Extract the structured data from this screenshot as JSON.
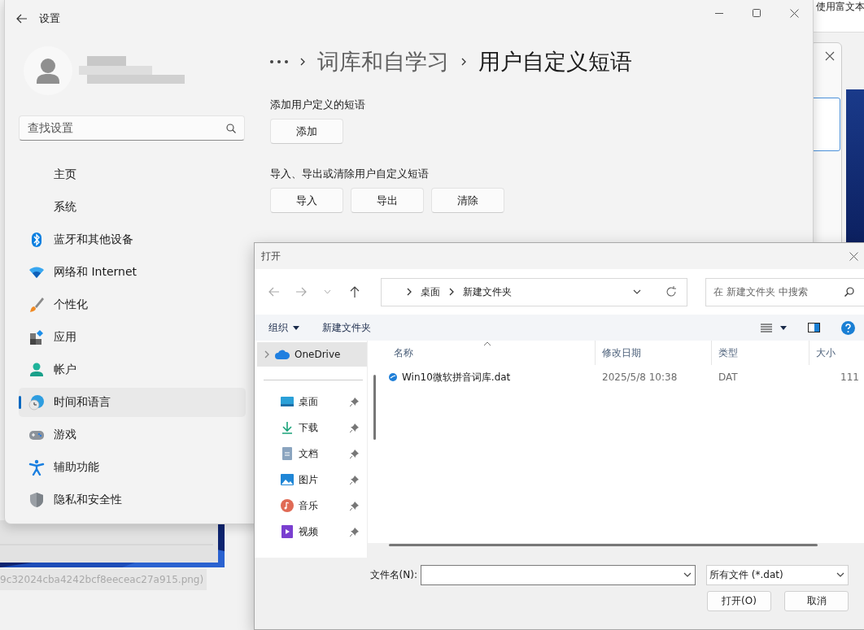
{
  "background": {
    "window_text": "使用富文本",
    "file_link": "9c32024cba4242bcf8eeceac27a915.png)"
  },
  "settings": {
    "title": "设置",
    "search": {
      "placeholder": "查找设置"
    },
    "nav": [
      {
        "label": "主页",
        "selected": false
      },
      {
        "label": "系统",
        "selected": false
      },
      {
        "label": "蓝牙和其他设备",
        "selected": false
      },
      {
        "label": "网络和 Internet",
        "selected": false
      },
      {
        "label": "个性化",
        "selected": false
      },
      {
        "label": "应用",
        "selected": false
      },
      {
        "label": "帐户",
        "selected": false
      },
      {
        "label": "时间和语言",
        "selected": true
      },
      {
        "label": "游戏",
        "selected": false
      },
      {
        "label": "辅助功能",
        "selected": false
      },
      {
        "label": "隐私和安全性",
        "selected": false
      }
    ],
    "breadcrumb": [
      {
        "label": "词库和自学习",
        "current": false
      },
      {
        "label": "用户自定义短语",
        "current": true
      }
    ],
    "sections": [
      {
        "label": "添加用户定义的短语",
        "buttons": [
          "添加"
        ]
      },
      {
        "label": "导入、导出或清除用户自定义短语",
        "buttons": [
          "导入",
          "导出",
          "清除"
        ]
      }
    ]
  },
  "dialog": {
    "title": "打开",
    "path": [
      "桌面",
      "新建文件夹"
    ],
    "search": {
      "placeholder": "在 新建文件夹 中搜索"
    },
    "toolbar": {
      "organize": "组织",
      "new_folder": "新建文件夹"
    },
    "nav_top": {
      "label": "OneDrive",
      "selected": true
    },
    "quick_access": [
      {
        "label": "桌面",
        "pinned": true,
        "selected": false
      },
      {
        "label": "下载",
        "pinned": true,
        "selected": false
      },
      {
        "label": "文档",
        "pinned": true,
        "selected": false
      },
      {
        "label": "图片",
        "pinned": true,
        "selected": false
      },
      {
        "label": "音乐",
        "pinned": true,
        "selected": false
      },
      {
        "label": "视频",
        "pinned": true,
        "selected": false
      }
    ],
    "columns": [
      "名称",
      "修改日期",
      "类型",
      "大小"
    ],
    "rows": [
      {
        "name": "Win10微软拼音词库.dat",
        "modified": "2025/5/8 10:38",
        "type": "DAT",
        "size": "111",
        "selected": false
      }
    ],
    "filename_label": "文件名(N):",
    "filetype": "所有文件 (*.dat)",
    "buttons": [
      "打开(O)",
      "取消"
    ]
  }
}
